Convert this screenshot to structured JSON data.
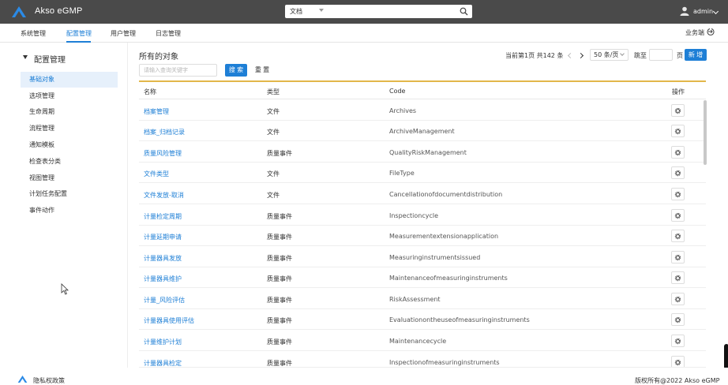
{
  "app": {
    "brand": "Akso eGMP",
    "user": "admin",
    "business_link": "业务端"
  },
  "search": {
    "type_selected": "文档",
    "placeholder": ""
  },
  "nav": {
    "tabs": [
      "系统管理",
      "配置管理",
      "用户管理",
      "日志管理"
    ],
    "active": "配置管理"
  },
  "sidebar": {
    "title": "配置管理",
    "items": [
      "基础对象",
      "选项管理",
      "生命周期",
      "流程管理",
      "通知模板",
      "检查表分类",
      "视图管理",
      "计划任务配置",
      "事件动作"
    ],
    "active": "基础对象"
  },
  "main": {
    "title": "所有的对象",
    "query_placeholder": "请输入查询关键字",
    "search_button": "搜 索",
    "reset_button": "重 置",
    "add_button": "新 增",
    "pagination": {
      "info": "当前第1页 共142 条",
      "page_size": "50 条/页",
      "goto_label": "跳至",
      "page_suffix": "页"
    },
    "columns": [
      "名称",
      "类型",
      "Code",
      "操作"
    ],
    "rows": [
      {
        "name": "档案管理",
        "type": "文件",
        "code": "Archives"
      },
      {
        "name": "档案_归档记录",
        "type": "文件",
        "code": "ArchiveManagement"
      },
      {
        "name": "质量风险管理",
        "type": "质量事件",
        "code": "QualityRiskManagement"
      },
      {
        "name": "文件类型",
        "type": "文件",
        "code": "FileType"
      },
      {
        "name": "文件发放-取消",
        "type": "文件",
        "code": "Cancellationofdocumentdistribution"
      },
      {
        "name": "计量检定周期",
        "type": "质量事件",
        "code": "Inspectioncycle"
      },
      {
        "name": "计量延期申请",
        "type": "质量事件",
        "code": "Measurementextensionapplication"
      },
      {
        "name": "计量器具发放",
        "type": "质量事件",
        "code": "Measuringinstrumentsissued"
      },
      {
        "name": "计量器具维护",
        "type": "质量事件",
        "code": "Maintenanceofmeasuringinstruments"
      },
      {
        "name": "计量_风险评估",
        "type": "质量事件",
        "code": "RiskAssessment"
      },
      {
        "name": "计量器具使用评估",
        "type": "质量事件",
        "code": "Evaluationontheuseofmeasuringinstruments"
      },
      {
        "name": "计量维护计划",
        "type": "质量事件",
        "code": "Maintenancecycle"
      },
      {
        "name": "计量器具检定",
        "type": "质量事件",
        "code": "Inspectionofmeasuringinstruments"
      }
    ]
  },
  "footer": {
    "privacy": "隐私权政策",
    "copyright": "版权所有@2022 Akso eGMP"
  },
  "colors": {
    "header_bg": "#4a4a4a",
    "accent": "#1e7fd6",
    "table_divider": "#e2b74a",
    "active_item_bg": "#e6f0fb"
  }
}
